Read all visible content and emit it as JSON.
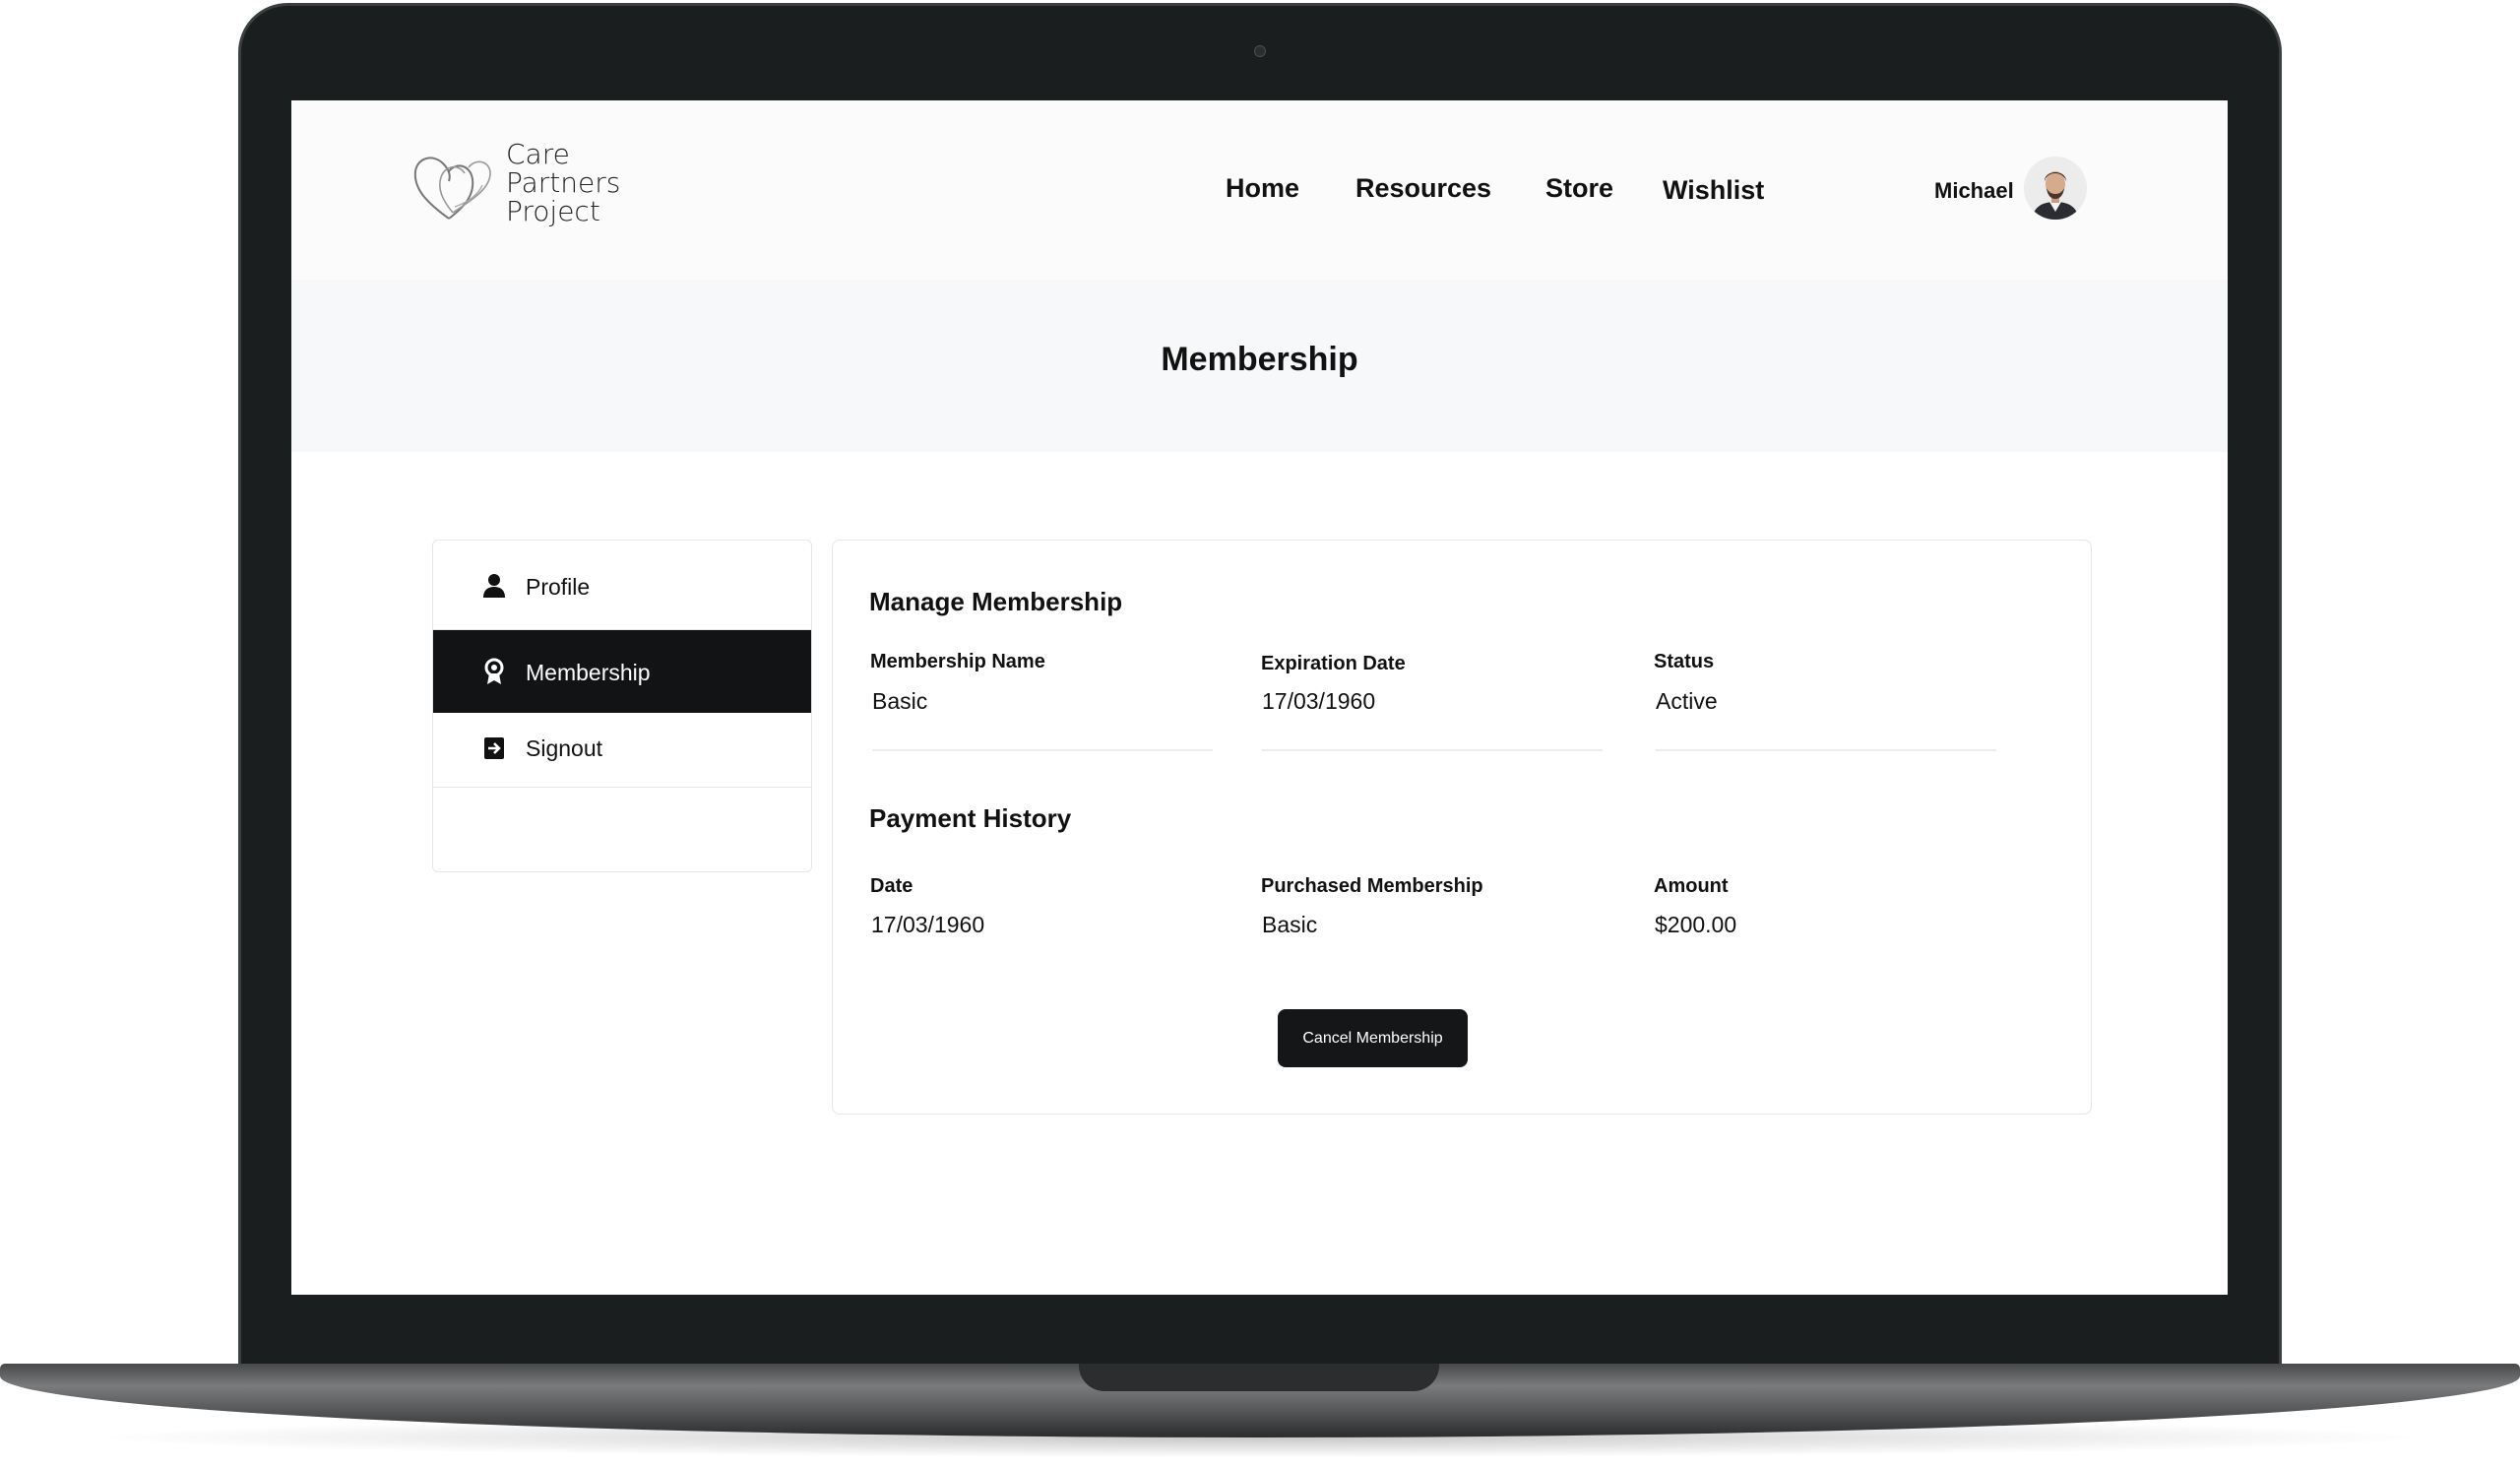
{
  "header": {
    "logo": {
      "line1": "Care",
      "line2": "Partners",
      "line3": "Project"
    },
    "nav": [
      {
        "label": "Home"
      },
      {
        "label": "Resources"
      },
      {
        "label": "Store"
      },
      {
        "label": "Wishlist"
      }
    ],
    "user": {
      "name": "Michael"
    }
  },
  "banner": {
    "title": "Membership"
  },
  "sidebar": {
    "items": [
      {
        "label": "Profile",
        "icon": "user-icon"
      },
      {
        "label": "Membership",
        "icon": "badge-icon",
        "active": true
      },
      {
        "label": "Signout",
        "icon": "signout-icon"
      }
    ]
  },
  "manage": {
    "title": "Manage Membership",
    "fields": [
      {
        "label": "Membership Name",
        "value": "Basic"
      },
      {
        "label": "Expiration Date",
        "value": "17/03/1960"
      },
      {
        "label": "Status",
        "value": "Active"
      }
    ]
  },
  "payments": {
    "title": "Payment History",
    "columns": [
      "Date",
      "Purchased Membership",
      "Amount"
    ],
    "rows": [
      {
        "date": "17/03/1960",
        "membership": "Basic",
        "amount": "$200.00"
      }
    ]
  },
  "actions": {
    "cancel_label": "Cancel Membership"
  },
  "colors": {
    "primary_dark": "#141617",
    "banner_bg": "#f7f8f9",
    "laptop_frame": "#1b1e1e"
  }
}
